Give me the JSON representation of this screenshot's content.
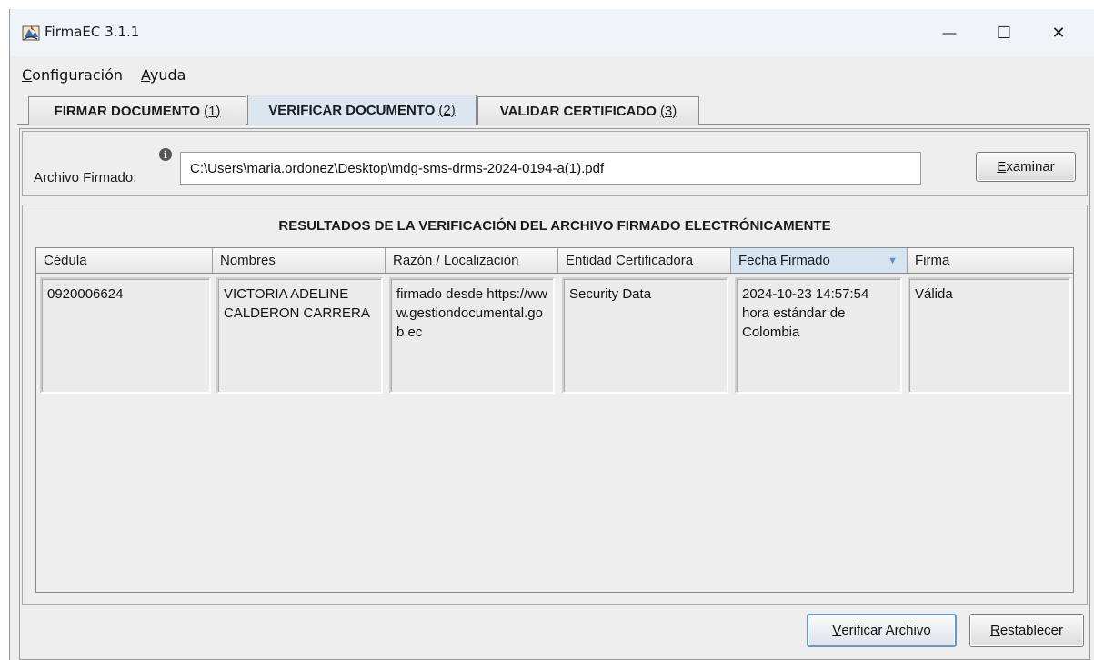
{
  "window": {
    "title": "FirmaEC 3.1.1",
    "controls": {
      "minimize": "—",
      "maximize": "☐",
      "close": "✕"
    }
  },
  "menu": {
    "config_mnemonic": "C",
    "config_rest": "onfiguración",
    "ayuda_mnemonic": "A",
    "ayuda_rest": "yuda"
  },
  "tabs": [
    {
      "label": "FIRMAR DOCUMENTO",
      "mnemonic": "(1)",
      "selected": false
    },
    {
      "label": "VERIFICAR DOCUMENTO",
      "mnemonic": "(2)",
      "selected": true
    },
    {
      "label": "VALIDAR CERTIFICADO",
      "mnemonic": "(3)",
      "selected": false
    }
  ],
  "file": {
    "label": "Archivo Firmado:",
    "info_glyph": "i",
    "value": "C:\\Users\\maria.ordonez\\Desktop\\mdg-sms-drms-2024-0194-a(1).pdf",
    "browse_mnemonic": "E",
    "browse_rest": "xaminar"
  },
  "results": {
    "title": "RESULTADOS DE LA VERIFICACIÓN DEL ARCHIVO FIRMADO ELECTRÓNICAMENTE",
    "columns": [
      "Cédula",
      "Nombres",
      "Razón / Localización",
      "Entidad Certificadora",
      "Fecha Firmado",
      "Firma"
    ],
    "sorted_column_index": 4,
    "sort_indicator": "▼",
    "rows": [
      {
        "cedula": "0920006624",
        "nombres": "VICTORIA ADELINE CALDERON CARRERA",
        "razon": "firmado desde https://www.gestiondocumental.gob.ec",
        "entidad": "Security Data",
        "fecha": "2024-10-23 14:57:54 hora estándar de Colombia",
        "firma": "Válida"
      }
    ]
  },
  "actions": {
    "verify_mnemonic": "V",
    "verify_rest": "erificar Archivo",
    "reset_mnemonic": "R",
    "reset_rest": "establecer"
  },
  "colors": {
    "selected_tab": "#dbe6f1",
    "sorted_header": "#d6e4f2",
    "focus_border": "#6b95c4"
  }
}
